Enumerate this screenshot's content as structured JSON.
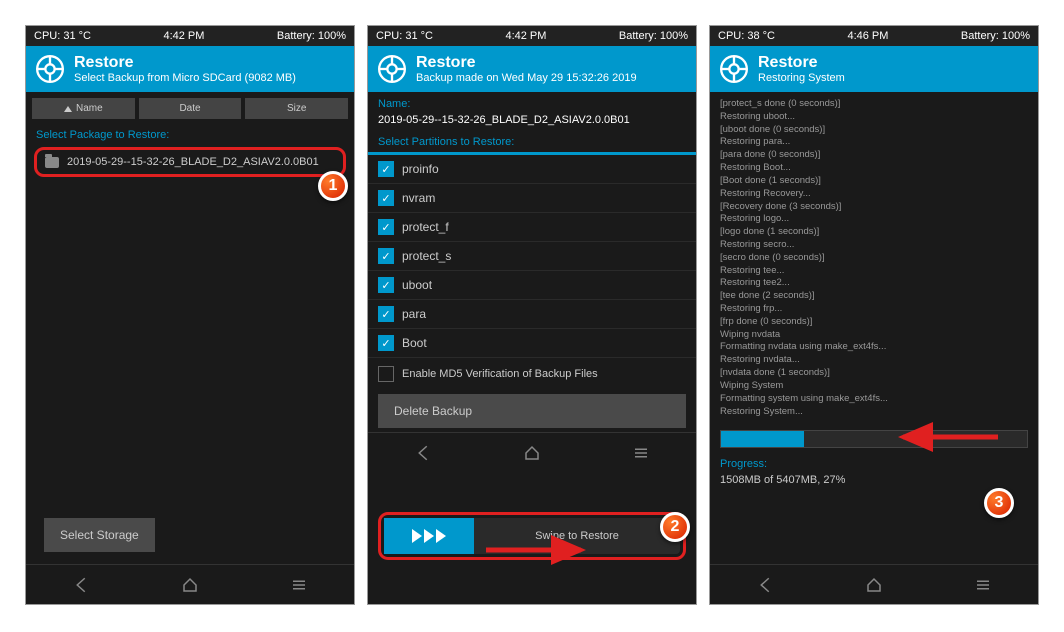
{
  "screen1": {
    "status": {
      "cpu": "CPU: 31 °C",
      "time": "4:42 PM",
      "battery": "Battery: 100%"
    },
    "header": {
      "title": "Restore",
      "subtitle": "Select Backup from Micro SDCard (9082 MB)"
    },
    "sort": {
      "name": "Name",
      "date": "Date",
      "size": "Size"
    },
    "section_label": "Select Package to Restore:",
    "folder_name": "2019-05-29--15-32-26_BLADE_D2_ASIAV2.0.0B01",
    "select_storage": "Select Storage",
    "badge": "1"
  },
  "screen2": {
    "status": {
      "cpu": "CPU: 31 °C",
      "time": "4:42 PM",
      "battery": "Battery: 100%"
    },
    "header": {
      "title": "Restore",
      "subtitle": "Backup made on Wed May 29 15:32:26 2019"
    },
    "name_label": "Name:",
    "backup_name": "2019-05-29--15-32-26_BLADE_D2_ASIAV2.0.0B01",
    "partitions_label": "Select Partitions to Restore:",
    "partitions": [
      "proinfo",
      "nvram",
      "protect_f",
      "protect_s",
      "uboot",
      "para",
      "Boot"
    ],
    "md5_label": "Enable MD5 Verification of Backup Files",
    "delete_label": "Delete Backup",
    "swipe_label": "Swipe to Restore",
    "badge": "2"
  },
  "screen3": {
    "status": {
      "cpu": "CPU: 38 °C",
      "time": "4:46 PM",
      "battery": "Battery: 100%"
    },
    "header": {
      "title": "Restore",
      "subtitle": "Restoring System"
    },
    "log": [
      "[protect_s done (0 seconds)]",
      "Restoring uboot...",
      "[uboot done (0 seconds)]",
      "Restoring para...",
      "[para done (0 seconds)]",
      "Restoring Boot...",
      "[Boot done (1 seconds)]",
      "Restoring Recovery...",
      "[Recovery done (3 seconds)]",
      "Restoring logo...",
      "[logo done (1 seconds)]",
      "Restoring secro...",
      "[secro done (0 seconds)]",
      "Restoring tee...",
      "Restoring tee2...",
      "[tee done (2 seconds)]",
      "Restoring frp...",
      "[frp done (0 seconds)]",
      "Wiping nvdata",
      "Formatting nvdata using make_ext4fs...",
      "Restoring nvdata...",
      "[nvdata done (1 seconds)]",
      "Wiping System",
      "Formatting system using make_ext4fs...",
      "Restoring System..."
    ],
    "progress_pct": 27,
    "progress_label": "Progress:",
    "progress_text": "1508MB of 5407MB, 27%",
    "badge": "3"
  }
}
